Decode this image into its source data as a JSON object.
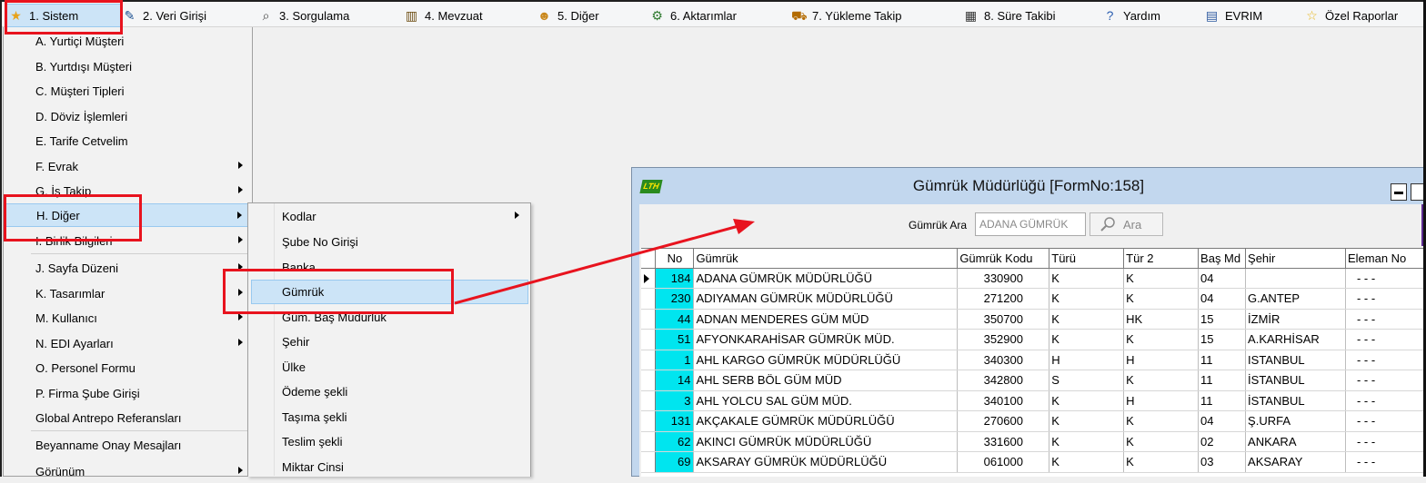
{
  "menubar": {
    "items": [
      {
        "label": "1. Sistem",
        "icon": "star-icon"
      },
      {
        "label": "2. Veri Girişi",
        "icon": "edit-icon"
      },
      {
        "label": "3. Sorgulama",
        "icon": "magnifier-icon"
      },
      {
        "label": "4. Mevzuat",
        "icon": "books-icon"
      },
      {
        "label": "5. Diğer",
        "icon": "people-icon"
      },
      {
        "label": "6. Aktarımlar",
        "icon": "gears-icon"
      },
      {
        "label": "7. Yükleme Takip",
        "icon": "truck-icon"
      },
      {
        "label": "8. Süre Takibi",
        "icon": "calendar-icon"
      },
      {
        "label": "Yardım",
        "icon": "help-icon"
      },
      {
        "label": "EVRIM",
        "icon": "book-icon"
      },
      {
        "label": "Özel Raporlar",
        "icon": "star-icon"
      }
    ]
  },
  "sistem_menu": {
    "items": [
      {
        "label": "A.  Yurtiçi Müşteri"
      },
      {
        "label": "B.  Yurtdışı Müşteri"
      },
      {
        "label": "C.  Müşteri Tipleri"
      },
      {
        "label": "D.  Döviz İşlemleri"
      },
      {
        "label": "E.  Tarife Cetvelim"
      },
      {
        "label": "F.  Evrak"
      },
      {
        "label": "G.  İş Takip"
      },
      {
        "label": "H.  Diğer"
      },
      {
        "label": "I.  Birlik Bilgileri"
      },
      {
        "label": "J.  Sayfa Düzeni"
      },
      {
        "label": "K.  Tasarımlar"
      },
      {
        "label": "M.  Kullanıcı"
      },
      {
        "label": "N.  EDI Ayarları"
      },
      {
        "label": "O.  Personel Formu"
      },
      {
        "label": "P.   Firma Şube Girişi"
      },
      {
        "label": "Global Antrepo Referansları"
      },
      {
        "label": "Beyanname Onay Mesajları"
      },
      {
        "label": "Görünüm"
      }
    ]
  },
  "diger_submenu": {
    "items": [
      {
        "label": "Kodlar"
      },
      {
        "label": "Şube No Girişi"
      },
      {
        "label": "Banka"
      },
      {
        "label": "Gümrük"
      },
      {
        "label": "Güm. Baş Müdürlük"
      },
      {
        "label": "Şehir"
      },
      {
        "label": "Ülke"
      },
      {
        "label": "Ödeme şekli"
      },
      {
        "label": "Taşıma şekli"
      },
      {
        "label": "Teslim şekli"
      },
      {
        "label": "Miktar Cinsi"
      }
    ]
  },
  "window": {
    "title": "Gümrük Müdürlüğü [FormNo:158]",
    "search_label": "Gümrük Ara",
    "search_value": "ADANA GÜMRÜK",
    "search_button": "Ara",
    "columns": [
      "No",
      "Gümrük",
      "Gümrük Kodu",
      "Türü",
      "Tür 2",
      "Baş Md",
      "Şehir",
      "Eleman No"
    ],
    "rows": [
      {
        "no": "184",
        "gumruk": "ADANA GÜMRÜK MÜDÜRLÜĞÜ",
        "kod": "330900",
        "turu": "K",
        "tur2": "K",
        "basmd": "04",
        "sehir": "",
        "eleman": "- - -"
      },
      {
        "no": "230",
        "gumruk": "ADIYAMAN GÜMRÜK MÜDÜRLÜĞÜ",
        "kod": "271200",
        "turu": "K",
        "tur2": "K",
        "basmd": "04",
        "sehir": "G.ANTEP",
        "eleman": "- - -"
      },
      {
        "no": "44",
        "gumruk": "ADNAN MENDERES GÜM MÜD",
        "kod": "350700",
        "turu": "K",
        "tur2": "HK",
        "basmd": "15",
        "sehir": "İZMİR",
        "eleman": "- - -"
      },
      {
        "no": "51",
        "gumruk": "AFYONKARAHİSAR GÜMRÜK MÜD.",
        "kod": "352900",
        "turu": "K",
        "tur2": "K",
        "basmd": "15",
        "sehir": "A.KARHİSAR",
        "eleman": "- - -"
      },
      {
        "no": "1",
        "gumruk": "AHL KARGO GÜMRÜK MÜDÜRLÜĞÜ",
        "kod": "340300",
        "turu": "H",
        "tur2": "H",
        "basmd": "11",
        "sehir": "ISTANBUL",
        "eleman": "- - -"
      },
      {
        "no": "14",
        "gumruk": "AHL SERB BÖL GÜM MÜD",
        "kod": "342800",
        "turu": "S",
        "tur2": "K",
        "basmd": "11",
        "sehir": "İSTANBUL",
        "eleman": "- - -"
      },
      {
        "no": "3",
        "gumruk": "AHL YOLCU SAL GÜM MÜD.",
        "kod": "340100",
        "turu": "K",
        "tur2": "H",
        "basmd": "11",
        "sehir": "İSTANBUL",
        "eleman": "- - -"
      },
      {
        "no": "131",
        "gumruk": "AKÇAKALE GÜMRÜK MÜDÜRLÜĞÜ",
        "kod": "270600",
        "turu": "K",
        "tur2": "K",
        "basmd": "04",
        "sehir": "Ş.URFA",
        "eleman": "- - -"
      },
      {
        "no": "62",
        "gumruk": "AKINCI GÜMRÜK MÜDÜRLÜĞÜ",
        "kod": "331600",
        "turu": "K",
        "tur2": "K",
        "basmd": "02",
        "sehir": "ANKARA",
        "eleman": "- - -"
      },
      {
        "no": "69",
        "gumruk": "AKSARAY GÜMRÜK MÜDÜRLÜĞÜ",
        "kod": "061000",
        "turu": "K",
        "tur2": "K",
        "basmd": "03",
        "sehir": "AKSARAY",
        "eleman": "- - -"
      }
    ]
  }
}
